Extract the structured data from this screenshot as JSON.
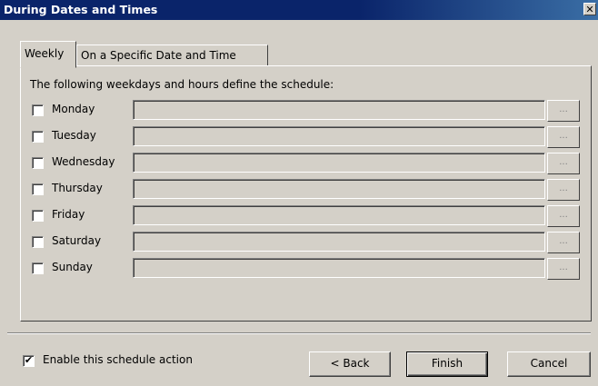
{
  "window": {
    "title": "During Dates and Times",
    "close_glyph": "✕"
  },
  "tabs": [
    {
      "label": "Weekly",
      "active": true
    },
    {
      "label": "On a Specific Date and Time",
      "active": false
    }
  ],
  "panel": {
    "description": "The following weekdays and hours define the schedule:"
  },
  "days": [
    {
      "label": "Monday",
      "checked": false,
      "value": "",
      "browse": "..."
    },
    {
      "label": "Tuesday",
      "checked": false,
      "value": "",
      "browse": "..."
    },
    {
      "label": "Wednesday",
      "checked": false,
      "value": "",
      "browse": "..."
    },
    {
      "label": "Thursday",
      "checked": false,
      "value": "",
      "browse": "..."
    },
    {
      "label": "Friday",
      "checked": false,
      "value": "",
      "browse": "..."
    },
    {
      "label": "Saturday",
      "checked": false,
      "value": "",
      "browse": "..."
    },
    {
      "label": "Sunday",
      "checked": false,
      "value": "",
      "browse": "..."
    }
  ],
  "footer": {
    "enable_label": "Enable this schedule action",
    "enable_checked": true,
    "enable_mark": "✔",
    "back_label": "< Back",
    "finish_label": "Finish",
    "cancel_label": "Cancel"
  },
  "colors": {
    "titlebar": "#0a246a",
    "face": "#d4d0c8"
  }
}
